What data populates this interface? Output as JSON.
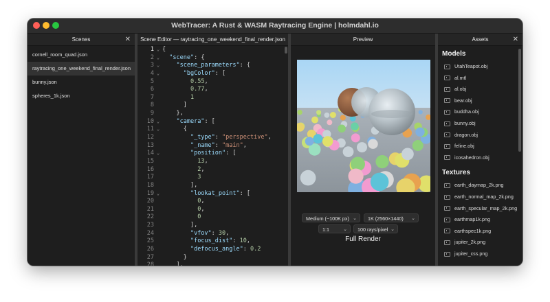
{
  "window": {
    "title": "WebTracer: A Rust & WASM Raytracing Engine | holmdahl.io"
  },
  "scenes": {
    "header": "Scenes",
    "close": "✕",
    "items": [
      {
        "label": "cornell_room_quad.json",
        "active": false
      },
      {
        "label": "raytracing_one_weekend_final_render.json",
        "active": true
      },
      {
        "label": "bunny.json",
        "active": false
      },
      {
        "label": "spheres_1k.json",
        "active": false
      }
    ]
  },
  "editor": {
    "header": "Scene Editor — raytracing_one_weekend_final_render.json",
    "lines": [
      {
        "n": "1",
        "fold": "⌄",
        "indent": "",
        "parts": [
          [
            "p",
            "{"
          ]
        ]
      },
      {
        "n": "2",
        "fold": "⌄",
        "indent": "  ",
        "parts": [
          [
            "k",
            "\"scene\""
          ],
          [
            "p",
            ": {"
          ]
        ]
      },
      {
        "n": "3",
        "fold": "⌄",
        "indent": "    ",
        "parts": [
          [
            "k",
            "\"scene_parameters\""
          ],
          [
            "p",
            ": {"
          ]
        ]
      },
      {
        "n": "4",
        "fold": "⌄",
        "indent": "      ",
        "parts": [
          [
            "k",
            "\"bgColor\""
          ],
          [
            "p",
            ": ["
          ]
        ]
      },
      {
        "n": "5",
        "fold": "",
        "indent": "        ",
        "parts": [
          [
            "n",
            "0.55"
          ],
          [
            "p",
            ","
          ]
        ]
      },
      {
        "n": "6",
        "fold": "",
        "indent": "        ",
        "parts": [
          [
            "n",
            "0.77"
          ],
          [
            "p",
            ","
          ]
        ]
      },
      {
        "n": "7",
        "fold": "",
        "indent": "        ",
        "parts": [
          [
            "n",
            "1"
          ]
        ]
      },
      {
        "n": "8",
        "fold": "",
        "indent": "      ",
        "parts": [
          [
            "p",
            "]"
          ]
        ]
      },
      {
        "n": "9",
        "fold": "",
        "indent": "    ",
        "parts": [
          [
            "p",
            "},"
          ]
        ]
      },
      {
        "n": "10",
        "fold": "⌄",
        "indent": "    ",
        "parts": [
          [
            "k",
            "\"camera\""
          ],
          [
            "p",
            ": ["
          ]
        ]
      },
      {
        "n": "11",
        "fold": "⌄",
        "indent": "      ",
        "parts": [
          [
            "p",
            "{"
          ]
        ]
      },
      {
        "n": "12",
        "fold": "",
        "indent": "        ",
        "parts": [
          [
            "k",
            "\"_type\""
          ],
          [
            "p",
            ": "
          ],
          [
            "s",
            "\"perspective\""
          ],
          [
            "p",
            ","
          ]
        ]
      },
      {
        "n": "13",
        "fold": "",
        "indent": "        ",
        "parts": [
          [
            "k",
            "\"_name\""
          ],
          [
            "p",
            ": "
          ],
          [
            "s",
            "\"main\""
          ],
          [
            "p",
            ","
          ]
        ]
      },
      {
        "n": "14",
        "fold": "⌄",
        "indent": "        ",
        "parts": [
          [
            "k",
            "\"position\""
          ],
          [
            "p",
            ": ["
          ]
        ]
      },
      {
        "n": "15",
        "fold": "",
        "indent": "          ",
        "parts": [
          [
            "n",
            "13"
          ],
          [
            "p",
            ","
          ]
        ]
      },
      {
        "n": "16",
        "fold": "",
        "indent": "          ",
        "parts": [
          [
            "n",
            "2"
          ],
          [
            "p",
            ","
          ]
        ]
      },
      {
        "n": "17",
        "fold": "",
        "indent": "          ",
        "parts": [
          [
            "n",
            "3"
          ]
        ]
      },
      {
        "n": "18",
        "fold": "",
        "indent": "        ",
        "parts": [
          [
            "p",
            "],"
          ]
        ]
      },
      {
        "n": "19",
        "fold": "⌄",
        "indent": "        ",
        "parts": [
          [
            "k",
            "\"lookat_point\""
          ],
          [
            "p",
            ": ["
          ]
        ]
      },
      {
        "n": "20",
        "fold": "",
        "indent": "          ",
        "parts": [
          [
            "n",
            "0"
          ],
          [
            "p",
            ","
          ]
        ]
      },
      {
        "n": "21",
        "fold": "",
        "indent": "          ",
        "parts": [
          [
            "n",
            "0"
          ],
          [
            "p",
            ","
          ]
        ]
      },
      {
        "n": "22",
        "fold": "",
        "indent": "          ",
        "parts": [
          [
            "n",
            "0"
          ]
        ]
      },
      {
        "n": "23",
        "fold": "",
        "indent": "        ",
        "parts": [
          [
            "p",
            "],"
          ]
        ]
      },
      {
        "n": "24",
        "fold": "",
        "indent": "        ",
        "parts": [
          [
            "k",
            "\"vfov\""
          ],
          [
            "p",
            ": "
          ],
          [
            "n",
            "30"
          ],
          [
            "p",
            ","
          ]
        ]
      },
      {
        "n": "25",
        "fold": "",
        "indent": "        ",
        "parts": [
          [
            "k",
            "\"focus_dist\""
          ],
          [
            "p",
            ": "
          ],
          [
            "n",
            "10"
          ],
          [
            "p",
            ","
          ]
        ]
      },
      {
        "n": "26",
        "fold": "",
        "indent": "        ",
        "parts": [
          [
            "k",
            "\"defocus_angle\""
          ],
          [
            "p",
            ": "
          ],
          [
            "n",
            "0.2"
          ]
        ]
      },
      {
        "n": "27",
        "fold": "",
        "indent": "      ",
        "parts": [
          [
            "p",
            "}"
          ]
        ]
      },
      {
        "n": "28",
        "fold": "",
        "indent": "    ",
        "parts": [
          [
            "p",
            "],"
          ]
        ]
      }
    ]
  },
  "preview": {
    "header": "Preview",
    "quality": "Medium (~100K px)",
    "resolution": "1K (2560×1440)",
    "aspect": "1:1",
    "rays": "100 rays/pixel",
    "render_button": "Full Render"
  },
  "assets": {
    "header": "Assets",
    "close": "✕",
    "models_title": "Models",
    "models": [
      "UtahTeapot.obj",
      "al.mtl",
      "al.obj",
      "bear.obj",
      "buddha.obj",
      "bunny.obj",
      "dragon.obj",
      "feline.obj",
      "icosahedron.obj"
    ],
    "textures_title": "Textures",
    "textures": [
      "earth_daymap_2k.png",
      "earth_normal_map_2k.png",
      "earth_specular_map_2k.png",
      "earthmap1k.png",
      "earthspec1k.png",
      "jupiter_2k.png",
      "jupiter_css.png"
    ]
  },
  "colors": {
    "window_bg": "#1e1e1e",
    "sky": "#a8d4f2",
    "ground": "#9aa3ab",
    "json_key": "#9cdcfe",
    "json_string": "#ce9178",
    "json_number": "#b5cea8"
  }
}
